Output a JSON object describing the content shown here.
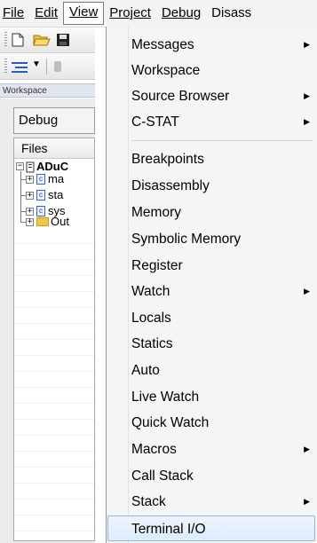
{
  "menubar": {
    "items": [
      "File",
      "Edit",
      "View",
      "Project",
      "Debug",
      "Disass"
    ],
    "active": "View"
  },
  "workspace": {
    "caption": "Workspace",
    "config": "Debug",
    "files_header": "Files",
    "tree": [
      "ADuC",
      "ma",
      "sta",
      "sys",
      "Out"
    ]
  },
  "view_menu": {
    "items": [
      {
        "label": "Messages",
        "submenu": true
      },
      {
        "label": "Workspace",
        "submenu": false
      },
      {
        "label": "Source Browser",
        "submenu": true
      },
      {
        "label": "C-STAT",
        "submenu": true
      },
      {
        "label": "Breakpoints",
        "submenu": false
      },
      {
        "label": "Disassembly",
        "submenu": false
      },
      {
        "label": "Memory",
        "submenu": false
      },
      {
        "label": "Symbolic Memory",
        "submenu": false
      },
      {
        "label": "Register",
        "submenu": false
      },
      {
        "label": "Watch",
        "submenu": true
      },
      {
        "label": "Locals",
        "submenu": false
      },
      {
        "label": "Statics",
        "submenu": false
      },
      {
        "label": "Auto",
        "submenu": false
      },
      {
        "label": "Live Watch",
        "submenu": false
      },
      {
        "label": "Quick Watch",
        "submenu": false
      },
      {
        "label": "Macros",
        "submenu": true
      },
      {
        "label": "Call Stack",
        "submenu": false
      },
      {
        "label": "Stack",
        "submenu": true
      },
      {
        "label": "Terminal I/O",
        "submenu": false
      }
    ],
    "highlighted": "Terminal I/O",
    "submenu_arrow": "▶"
  },
  "colors": {
    "highlight_border": "#8fb6e8",
    "highlight_fill": "#dcebfc",
    "folder": "#f4c542",
    "file_icon": "#3a64b8"
  }
}
